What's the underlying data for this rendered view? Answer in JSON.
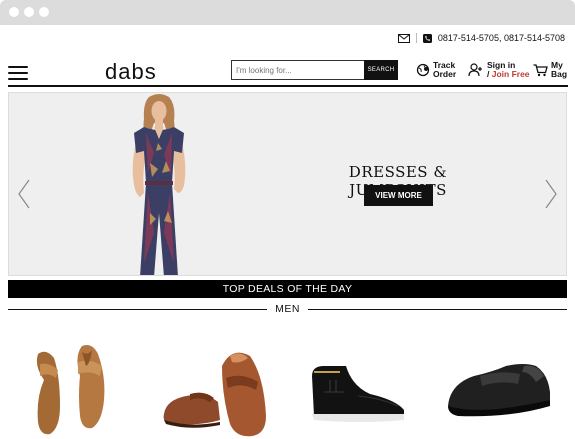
{
  "topbar": {
    "phones": "0817-514-5705, 0817-514-5708"
  },
  "header": {
    "logo": "dabs",
    "search_placeholder": "I'm looking for...",
    "search_button": "SEARCH",
    "track_line1": "Track",
    "track_line2": "Order",
    "signin_line1": "Sign in",
    "signin_sep": "/",
    "signin_join": "Join Free",
    "bag_line1": "My",
    "bag_line2": "Bag"
  },
  "banner": {
    "title": "DRESSES & JUMPSUITS",
    "cta": "VIEW MORE"
  },
  "deals": {
    "heading": "TOP DEALS OF THE DAY",
    "category": "MEN"
  },
  "colors": {
    "accent": "#c0392b",
    "dark": "#111111",
    "banner_bg": "#efefef"
  },
  "products": [
    {
      "icon": "sandal-image"
    },
    {
      "icon": "loafer-image"
    },
    {
      "icon": "high-top-sneaker-image"
    },
    {
      "icon": "running-shoe-image"
    }
  ]
}
